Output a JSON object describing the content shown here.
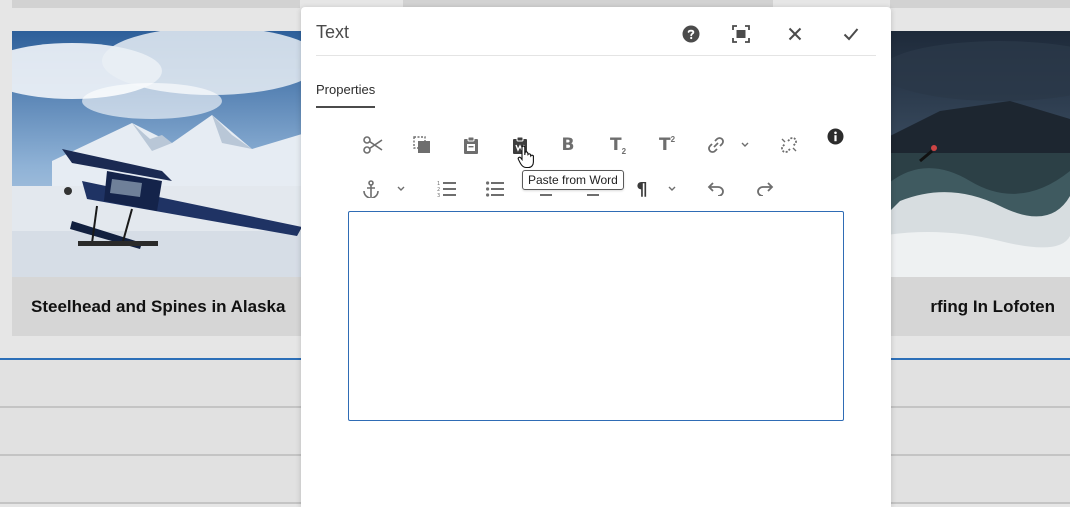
{
  "page": {
    "cards": [
      {
        "title": "Steelhead and Spines in Alaska"
      },
      {
        "title": "rfing In Lofoten"
      }
    ]
  },
  "dialog": {
    "title": "Text",
    "tabs": [
      {
        "label": "Properties"
      }
    ],
    "header_icons": [
      "help-icon",
      "fullscreen-icon",
      "close-icon",
      "done-icon"
    ],
    "toolbar": {
      "row1": [
        "cut-icon",
        "copy-icon",
        "paste-icon",
        "paste-from-word-icon",
        "bold-icon",
        "subscript-icon",
        "superscript-icon",
        "link-icon",
        "unlink-icon",
        "info-icon"
      ],
      "row2": [
        "anchor-icon",
        "numbered-list-icon",
        "bulleted-list-icon",
        "outdent-icon",
        "indent-icon",
        "paragraph-icon",
        "undo-icon",
        "redo-icon"
      ],
      "bold_glyph": "B",
      "subscript_glyph": "T",
      "superscript_glyph": "T",
      "subscript_mark": "2",
      "superscript_mark": "2",
      "paragraph_glyph": "¶"
    },
    "tooltip": "Paste from Word",
    "editor": {
      "value": ""
    }
  },
  "colors": {
    "accent": "#2f6cb5",
    "icon": "#6e6e6e"
  }
}
